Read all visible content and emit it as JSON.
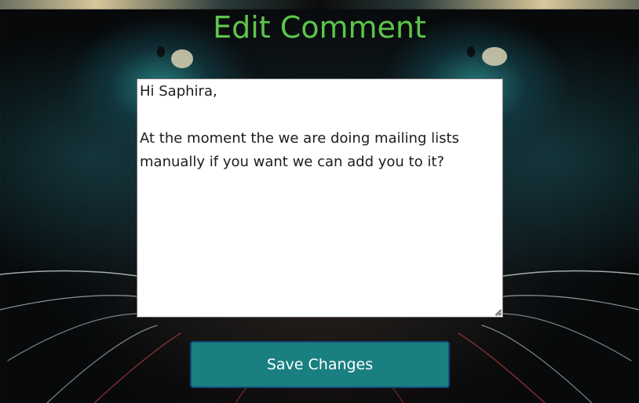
{
  "page": {
    "title": "Edit Comment"
  },
  "comment": {
    "value": "Hi Saphira,\n\nAt the moment the we are doing mailing lists manually if you want we can add you to it?"
  },
  "actions": {
    "save_label": "Save Changes"
  },
  "colors": {
    "title": "#5dc54a",
    "button": "#1a7f80",
    "button_border": "#124a7a"
  },
  "icons": {
    "resize_grip": "resize-grip-icon"
  }
}
